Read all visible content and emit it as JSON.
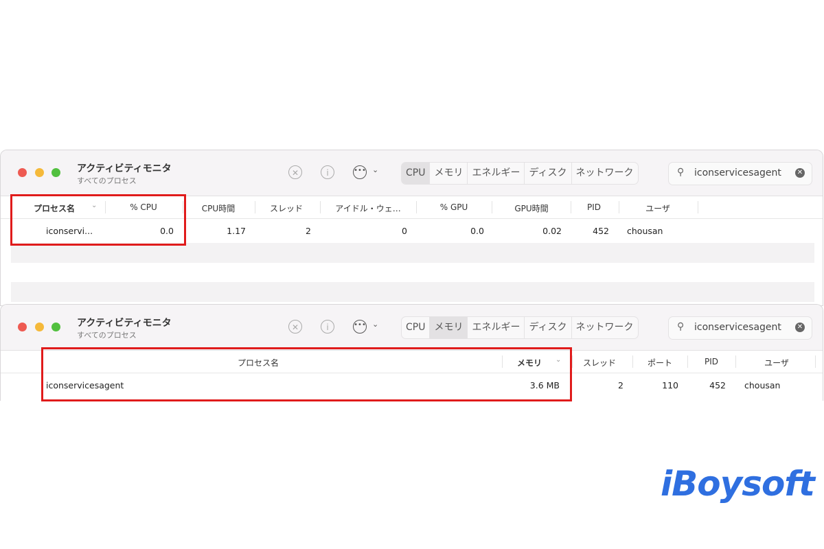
{
  "window_top": {
    "title": "アクティビティモニタ",
    "subtitle": "すべてのプロセス",
    "tabs": [
      "CPU",
      "メモリ",
      "エネルギー",
      "ディスク",
      "ネットワーク"
    ],
    "active_tab": "CPU",
    "search_value": "iconservicesagent",
    "columns": [
      "プロセス名",
      "% CPU",
      "CPU時間",
      "スレッド",
      "アイドル・ウェ…",
      "% GPU",
      "GPU時間",
      "PID",
      "ユーザ"
    ],
    "row": [
      "iconservi...",
      "0.0",
      "1.17",
      "2",
      "0",
      "0.0",
      "0.02",
      "452",
      "chousan"
    ]
  },
  "window_bottom": {
    "title": "アクティビティモニタ",
    "subtitle": "すべてのプロセス",
    "tabs": [
      "CPU",
      "メモリ",
      "エネルギー",
      "ディスク",
      "ネットワーク"
    ],
    "active_tab": "メモリ",
    "search_value": "iconservicesagent",
    "columns": [
      "プロセス名",
      "メモリ",
      "スレッド",
      "ポート",
      "PID",
      "ユーザ"
    ],
    "row": [
      "iconservicesagent",
      "3.6 MB",
      "2",
      "110",
      "452",
      "chousan"
    ]
  },
  "icons": {
    "stop": "x-circle-icon",
    "info": "info-icon",
    "more": "ellipsis-circle-icon",
    "search": "magnifier-icon",
    "clear": "clear-icon"
  },
  "colors": {
    "highlight": "#e01b1b",
    "logo": "#2f6fe0"
  },
  "logo": "iBoysoft"
}
